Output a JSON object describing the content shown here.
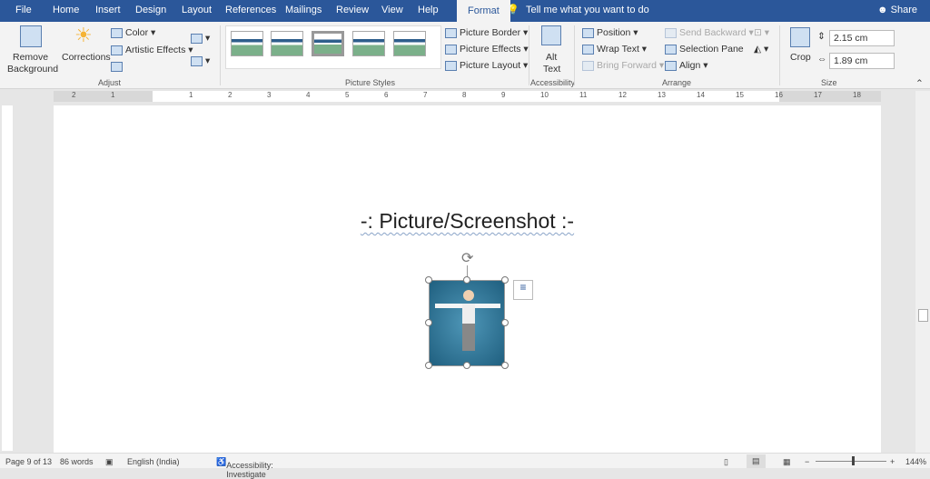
{
  "tabs": [
    "File",
    "Home",
    "Insert",
    "Design",
    "Layout",
    "References",
    "Mailings",
    "Review",
    "View",
    "Help",
    "Format"
  ],
  "active_tab": "Format",
  "tell_me": "Tell me what you want to do",
  "share": "Share",
  "ribbon": {
    "remove_bg": [
      "Remove",
      "Background"
    ],
    "corrections": "Corrections",
    "color": "Color",
    "artistic": "Artistic Effects",
    "adjust": "Adjust",
    "picture_styles": "Picture Styles",
    "border": "Picture Border",
    "effects": "Picture Effects",
    "layout": "Picture Layout",
    "alt_text": [
      "Alt",
      "Text"
    ],
    "accessibility": "Accessibility",
    "position": "Position",
    "wrap": "Wrap Text",
    "bring": "Bring Forward",
    "send": "Send Backward",
    "selection": "Selection Pane",
    "align": "Align",
    "arrange": "Arrange",
    "crop": "Crop",
    "height": "2.15 cm",
    "width": "1.89 cm",
    "size": "Size"
  },
  "document": {
    "heading": "-: Picture/Screenshot :-"
  },
  "ruler": {
    "left": [
      "2",
      "1"
    ],
    "right": [
      "1",
      "2",
      "3",
      "4",
      "5",
      "6",
      "7",
      "8",
      "9",
      "10",
      "11",
      "12",
      "13",
      "14",
      "15",
      "16",
      "17",
      "18"
    ]
  },
  "status": {
    "page": "Page 9 of 13",
    "words": "86 words",
    "language": "English (India)",
    "accessibility": "Accessibility: Investigate",
    "zoom": "144%"
  },
  "colors": {
    "brand": "#2b579a",
    "ribbon": "#f3f3f3"
  }
}
